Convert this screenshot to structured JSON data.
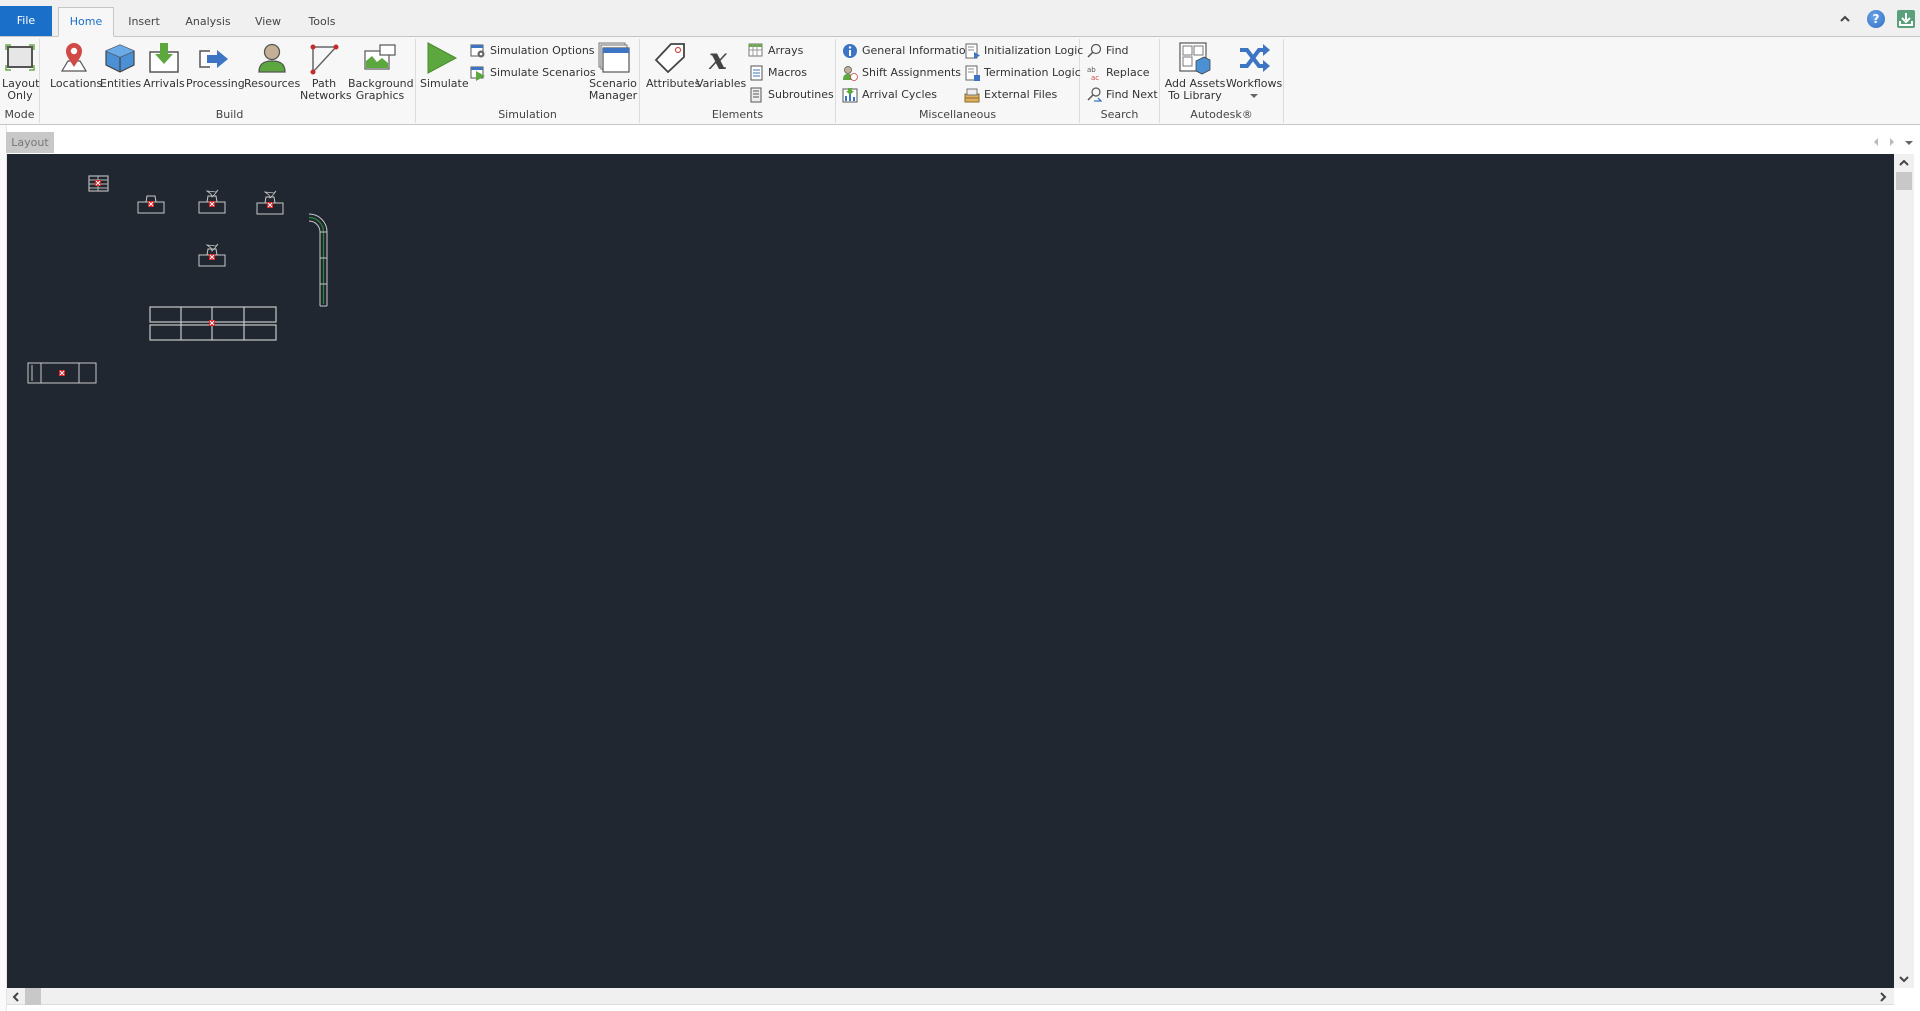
{
  "tabs": {
    "file": "File",
    "home": "Home",
    "insert": "Insert",
    "analysis": "Analysis",
    "view": "View",
    "tools": "Tools",
    "active": "Home"
  },
  "window_controls": {
    "collapse": "^",
    "help": "?"
  },
  "ribbon": {
    "mode": {
      "label": "Mode",
      "layout_only": [
        "Layout",
        "Only"
      ]
    },
    "build": {
      "label": "Build",
      "locations": "Locations",
      "entities": "Entities",
      "arrivals": "Arrivals",
      "processing": "Processing",
      "resources": "Resources",
      "path_networks": [
        "Path",
        "Networks"
      ],
      "background_graphics": [
        "Background",
        "Graphics"
      ]
    },
    "simulation": {
      "label": "Simulation",
      "simulate": "Simulate",
      "simulation_options": "Simulation Options",
      "simulate_scenarios": "Simulate Scenarios",
      "scenario_manager": [
        "Scenario",
        "Manager"
      ]
    },
    "elements": {
      "label": "Elements",
      "attributes": "Attributes",
      "variables": "Variables",
      "arrays": "Arrays",
      "macros": "Macros",
      "subroutines": "Subroutines"
    },
    "miscellaneous": {
      "label": "Miscellaneous",
      "general_information": "General Information",
      "shift_assignments": "Shift Assignments",
      "arrival_cycles": "Arrival Cycles",
      "initialization_logic": "Initialization Logic",
      "termination_logic": "Termination Logic",
      "external_files": "External Files"
    },
    "search": {
      "label": "Search",
      "find": "Find",
      "replace": "Replace",
      "find_next": "Find Next"
    },
    "autodesk": {
      "label": "Autodesk®",
      "add_assets": [
        "Add Assets",
        "To Library"
      ],
      "workflows": "Workflows"
    }
  },
  "document": {
    "tab_label": "Layout"
  },
  "colors": {
    "accent": "#1a6fc9",
    "canvas_bg": "#212730",
    "ribbon_bg": "#f7f7f7",
    "layout_line": "#c8c8c8",
    "marker_red": "#e02020",
    "conveyor_green": "#2e8b3a"
  }
}
